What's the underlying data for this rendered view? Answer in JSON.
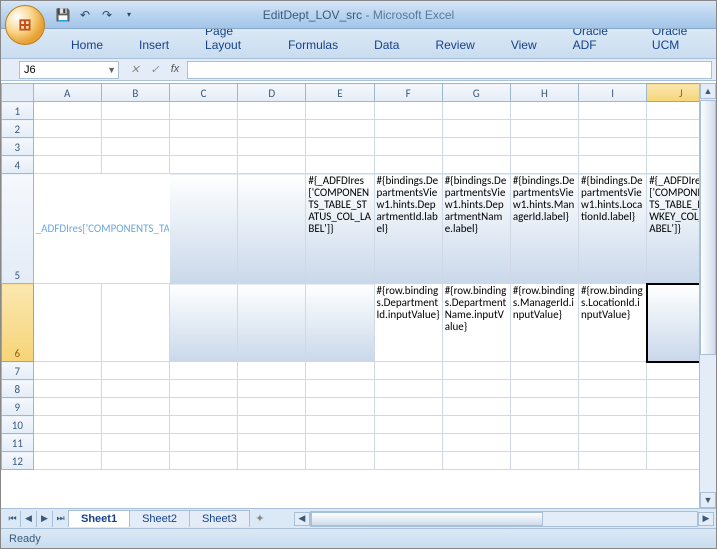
{
  "title": {
    "doc": "EditDept_LOV_src",
    "app": "Microsoft Excel"
  },
  "ribbon_tabs": [
    "Home",
    "Insert",
    "Page Layout",
    "Formulas",
    "Data",
    "Review",
    "View",
    "Oracle ADF",
    "Oracle UCM"
  ],
  "namebox": "J6",
  "formula": "",
  "columns": [
    "A",
    "B",
    "C",
    "D",
    "E",
    "F",
    "G",
    "H",
    "I",
    "J"
  ],
  "rows": [
    "1",
    "2",
    "3",
    "4",
    "5",
    "6",
    "7",
    "8",
    "9",
    "10",
    "11",
    "12"
  ],
  "row5": {
    "A_overflow": "_ADFDIres['COMPONENTS_TABLENTS_TABLE",
    "E": "#{_ADFDIres['COMPONENTS_TABLE_STATUS_COL_LABEL']}",
    "F": "#{bindings.DepartmentsView1.hints.DepartmentId.label}",
    "G": "#{bindings.DepartmentsView1.hints.DepartmentName.label}",
    "H": "#{bindings.DepartmentsView1.hints.ManagerId.label}",
    "I": "#{bindings.DepartmentsView1.hints.LocationId.label}",
    "J": "#{_ADFDIres['COMPONENTS_TABLE_ROWKEY_COL_LABEL']}"
  },
  "row6": {
    "F": "#{row.bindings.DepartmentId.inputValue}",
    "G": "#{row.bindings.DepartmentName.inputValue}",
    "H": "#{row.bindings.ManagerId.inputValue}",
    "I": "#{row.bindings.LocationId.inputValue}"
  },
  "sheets": [
    "Sheet1",
    "Sheet2",
    "Sheet3"
  ],
  "status": "Ready"
}
